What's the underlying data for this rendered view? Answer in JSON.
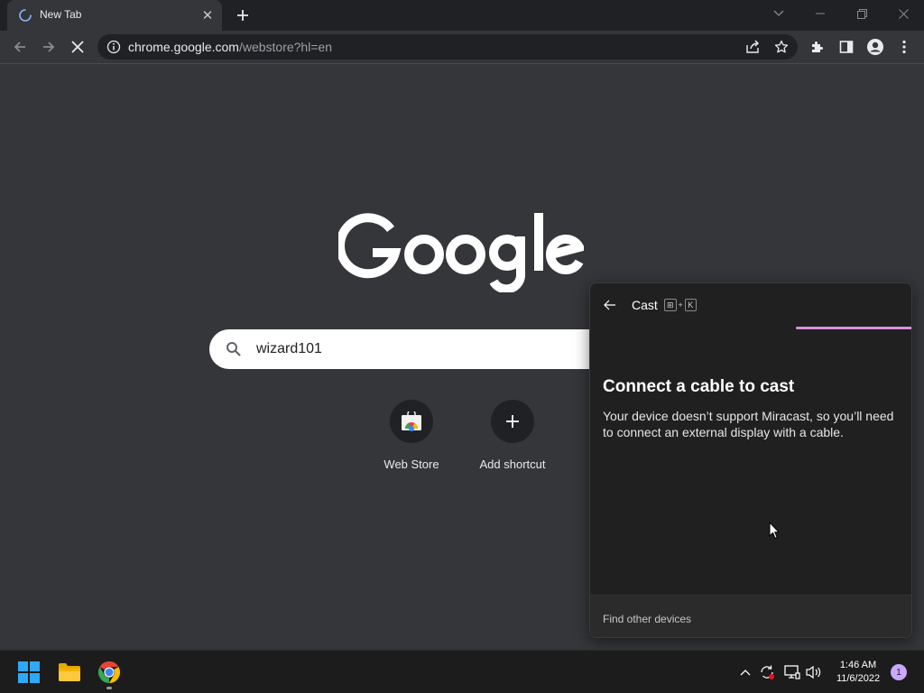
{
  "tab": {
    "title": "New Tab"
  },
  "omnibox": {
    "url_host": "chrome.google.com",
    "url_path": "/webstore?hl=en"
  },
  "search": {
    "value": "wizard101"
  },
  "shortcuts": [
    {
      "label": "Web Store",
      "icon": "web-store-icon"
    },
    {
      "label": "Add shortcut",
      "icon": "plus-icon"
    }
  ],
  "cast": {
    "title": "Cast",
    "key_win": "⊞",
    "key_plus": "+",
    "key_letter": "K",
    "heading": "Connect a cable to cast",
    "body": "Your device doesn’t support Miracast, so you’ll need to connect an external display with a cable.",
    "find_other": "Find other devices",
    "progress_color": "#d98fd9"
  },
  "taskbar": {
    "time": "1:46 AM",
    "date": "11/6/2022",
    "notifications": "1"
  }
}
